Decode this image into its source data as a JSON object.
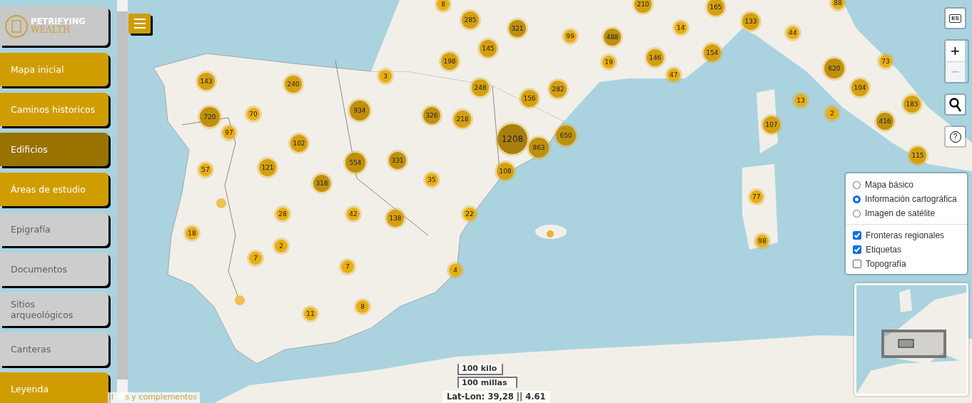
{
  "logo": {
    "line_1": "PETRIFYING",
    "line_2": "WEALTH"
  },
  "sidebar": {
    "items": [
      {
        "label": "Mapa inicial",
        "active": true,
        "selected": false
      },
      {
        "label": "Caminos historicos",
        "active": true,
        "selected": false
      },
      {
        "label": "Edificios",
        "active": true,
        "selected": true
      },
      {
        "label": "Áreas de estudio",
        "active": true,
        "selected": false
      },
      {
        "label": "Epigrafía",
        "active": false,
        "selected": false
      },
      {
        "label": "Documentos",
        "active": false,
        "selected": false
      },
      {
        "label": "Sitios arqueológicos",
        "active": false,
        "selected": false
      },
      {
        "label": "Canteras",
        "active": false,
        "selected": false
      },
      {
        "label": "Leyenda",
        "active": true,
        "selected": false
      }
    ]
  },
  "map": {
    "markers": [
      {
        "count": "8"
      },
      {
        "count": "285"
      },
      {
        "count": "321"
      },
      {
        "count": "99"
      },
      {
        "count": "488"
      },
      {
        "count": "210"
      },
      {
        "count": "165"
      },
      {
        "count": "133"
      },
      {
        "count": "88"
      },
      {
        "count": "14"
      },
      {
        "count": "44"
      },
      {
        "count": "145"
      },
      {
        "count": "198"
      },
      {
        "count": "19"
      },
      {
        "count": "146"
      },
      {
        "count": "154"
      },
      {
        "count": "47"
      },
      {
        "count": "73"
      },
      {
        "count": "620"
      },
      {
        "count": "3"
      },
      {
        "count": "240"
      },
      {
        "count": "143"
      },
      {
        "count": "248"
      },
      {
        "count": "156"
      },
      {
        "count": "282"
      },
      {
        "count": "104"
      },
      {
        "count": "13"
      },
      {
        "count": "183"
      },
      {
        "count": "934"
      },
      {
        "count": "326"
      },
      {
        "count": "218"
      },
      {
        "count": "720"
      },
      {
        "count": "70"
      },
      {
        "count": "2"
      },
      {
        "count": "416"
      },
      {
        "count": "97"
      },
      {
        "count": "107"
      },
      {
        "count": "1208"
      },
      {
        "count": "650"
      },
      {
        "count": "863"
      },
      {
        "count": "102"
      },
      {
        "count": "121"
      },
      {
        "count": "554"
      },
      {
        "count": "331"
      },
      {
        "count": "115"
      },
      {
        "count": "57"
      },
      {
        "count": "108"
      },
      {
        "count": "318"
      },
      {
        "count": "35"
      },
      {
        "count": "77"
      },
      {
        "count": "28"
      },
      {
        "count": "42"
      },
      {
        "count": "138"
      },
      {
        "count": "22"
      },
      {
        "count": "18"
      },
      {
        "count": "2"
      },
      {
        "count": "7"
      },
      {
        "count": "98"
      },
      {
        "count": "7"
      },
      {
        "count": "4"
      },
      {
        "count": "11"
      },
      {
        "count": "8"
      }
    ],
    "attribution": [
      "ll",
      "s y complementos"
    ],
    "scale": [
      "100 kilo",
      "100 millas"
    ],
    "coordinates": "Lat-Lon: 39,28 || 4.61"
  },
  "controls": {
    "language": "ES",
    "zoom_in": "+",
    "zoom_out": "−",
    "zoom_out_disabled": true,
    "help": "?"
  },
  "layers": {
    "base": [
      {
        "label": "Mapa básico",
        "selected": false
      },
      {
        "label": "Información cartográfica",
        "selected": true
      },
      {
        "label": "Imagen de satélite",
        "selected": false
      }
    ],
    "overlays": [
      {
        "label": "Fronteras regionales",
        "checked": true
      },
      {
        "label": "Etiquetas",
        "checked": true
      },
      {
        "label": "Topografía",
        "checked": false
      }
    ]
  }
}
